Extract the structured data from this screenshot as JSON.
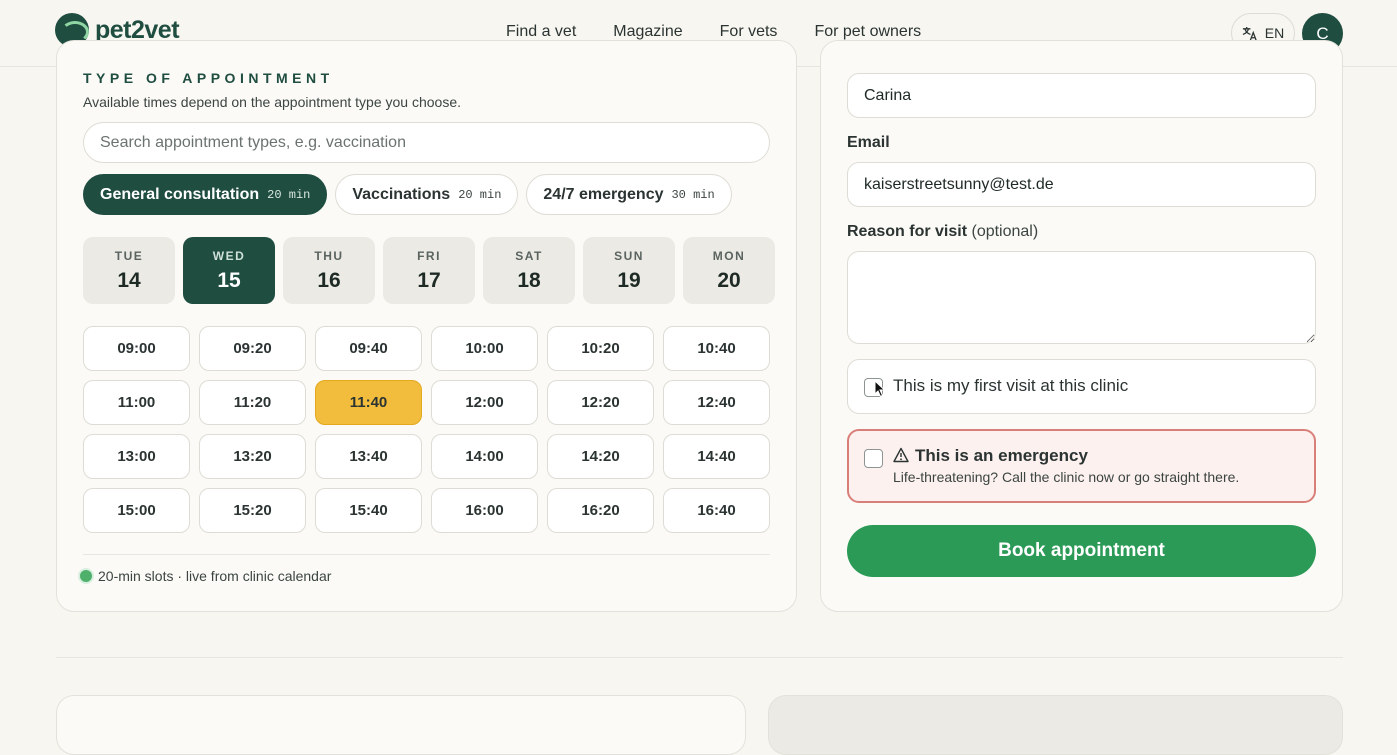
{
  "header": {
    "logo_text": "pet2vet",
    "nav": [
      "Find a vet",
      "Magazine",
      "For vets",
      "For pet owners"
    ],
    "lang": "EN",
    "avatar_initial": "C"
  },
  "appointment": {
    "kicker": "TYPE OF APPOINTMENT",
    "subtitle": "Available times depend on the appointment type you choose.",
    "search_placeholder": "Search appointment types, e.g. vaccination",
    "types": [
      {
        "label": "General consultation",
        "duration": "20 min",
        "active": true
      },
      {
        "label": "Vaccinations",
        "duration": "20 min",
        "active": false
      },
      {
        "label": "24/7 emergency",
        "duration": "30 min",
        "active": false
      }
    ],
    "days": [
      {
        "dow": "TUE",
        "num": "14",
        "active": false
      },
      {
        "dow": "WED",
        "num": "15",
        "active": true
      },
      {
        "dow": "THU",
        "num": "16",
        "active": false
      },
      {
        "dow": "FRI",
        "num": "17",
        "active": false
      },
      {
        "dow": "SAT",
        "num": "18",
        "active": false
      },
      {
        "dow": "SUN",
        "num": "19",
        "active": false
      },
      {
        "dow": "MON",
        "num": "20",
        "active": false
      }
    ],
    "slots": [
      "09:00",
      "09:20",
      "09:40",
      "10:00",
      "10:20",
      "10:40",
      "11:00",
      "11:20",
      "11:40",
      "12:00",
      "12:20",
      "12:40",
      "13:00",
      "13:20",
      "13:40",
      "14:00",
      "14:20",
      "14:40",
      "15:00",
      "15:20",
      "15:40",
      "16:00",
      "16:20",
      "16:40"
    ],
    "selected_slot": "11:40",
    "footnote": "20-min slots · live from clinic calendar"
  },
  "form": {
    "name_value": "Carina",
    "email_label": "Email",
    "email_value": "kaiserstreetsunny@test.de",
    "reason_label": "Reason for visit",
    "reason_optional": "(optional)",
    "reason_value": "",
    "first_visit_label": "This is my first visit at this clinic",
    "emergency_title": "This is an emergency",
    "emergency_sub": "Life-threatening? Call the clinic now or go straight there.",
    "book_label": "Book appointment"
  },
  "colors": {
    "brand_dark": "#1f4d40",
    "selected_slot": "#f2bd3c",
    "book_button": "#2b9a57",
    "emergency_border": "#d97f7a"
  }
}
